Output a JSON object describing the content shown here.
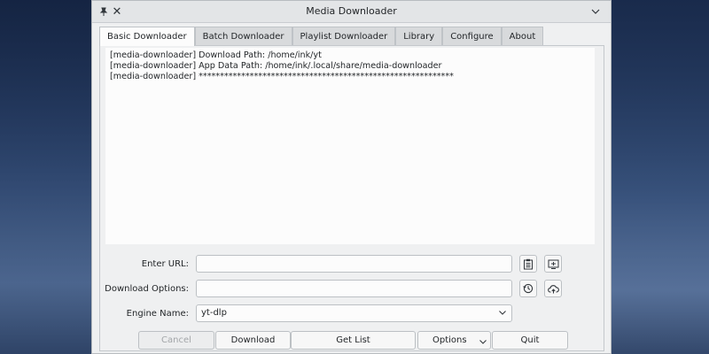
{
  "window": {
    "title": "Media Downloader"
  },
  "tabs": [
    {
      "label": "Basic Downloader",
      "active": true
    },
    {
      "label": "Batch Downloader"
    },
    {
      "label": "Playlist Downloader"
    },
    {
      "label": "Library"
    },
    {
      "label": "Configure"
    },
    {
      "label": "About"
    }
  ],
  "log": {
    "lines": [
      "[media-downloader] Download Path: /home/ink/yt",
      "[media-downloader] App Data Path: /home/ink/.local/share/media-downloader",
      "[media-downloader] ************************************************************"
    ]
  },
  "form": {
    "url_label": "Enter URL:",
    "url_value": "",
    "options_label": "Download Options:",
    "options_value": "",
    "engine_label": "Engine Name:",
    "engine_value": "yt-dlp"
  },
  "buttons": {
    "cancel": "Cancel",
    "download": "Download",
    "get_list": "Get List",
    "options": "Options",
    "quit": "Quit"
  },
  "icons": {
    "pin": "pin-icon",
    "close": "close-icon",
    "collapse": "chevron-down-icon",
    "paste": "clipboard-icon",
    "browse": "screen-icon",
    "history": "history-icon",
    "upload": "cloud-upload-icon"
  }
}
